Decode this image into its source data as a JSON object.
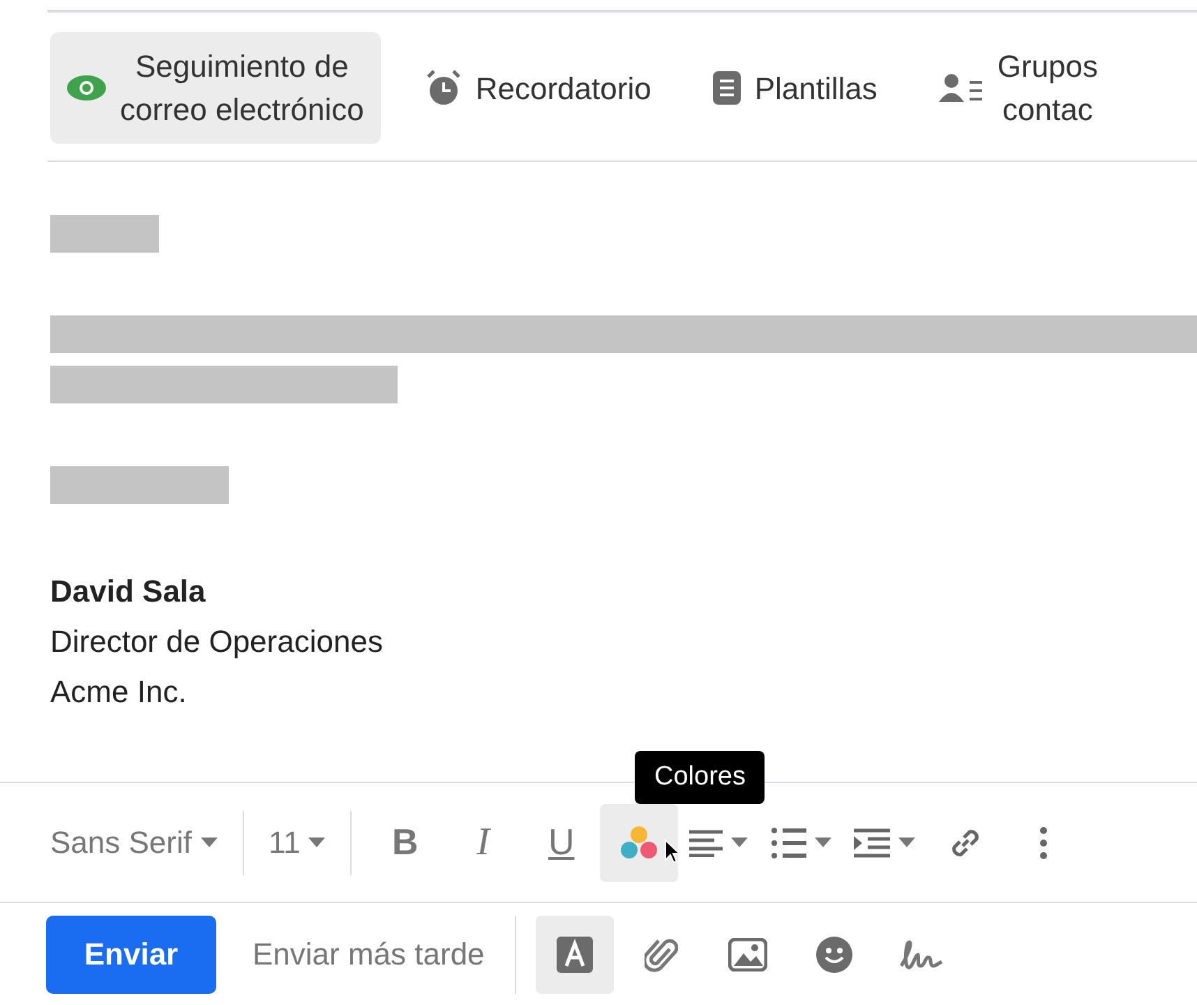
{
  "features": [
    {
      "kind": "eye",
      "lines": [
        "Seguimiento de",
        "correo electrónico"
      ],
      "selected": true
    },
    {
      "kind": "alarm",
      "lines": [
        "Recordatorio"
      ],
      "selected": false
    },
    {
      "kind": "template",
      "lines": [
        "Plantillas"
      ],
      "selected": false
    },
    {
      "kind": "contacts",
      "lines": [
        "Grupos",
        "contac"
      ],
      "selected": false
    }
  ],
  "body": [
    {
      "kind": "greeting"
    },
    {
      "kind": "blank"
    },
    {
      "kind": "paragraph"
    },
    {
      "kind": "continuation"
    },
    {
      "kind": "blank"
    },
    {
      "kind": "closing"
    },
    {
      "kind": "blank"
    }
  ],
  "signature": {
    "name": "David Sala",
    "lines": [
      "Director de Operaciones",
      "Acme Inc."
    ]
  },
  "format_toolbar": {
    "font": "Sans Serif",
    "size": "11",
    "bold": "B",
    "italic": "I",
    "underline": "U",
    "tooltip": "Colores"
  },
  "compose_bar": {
    "send": "Enviar",
    "send_later": "Enviar más tarde",
    "formatting_selected": true
  }
}
